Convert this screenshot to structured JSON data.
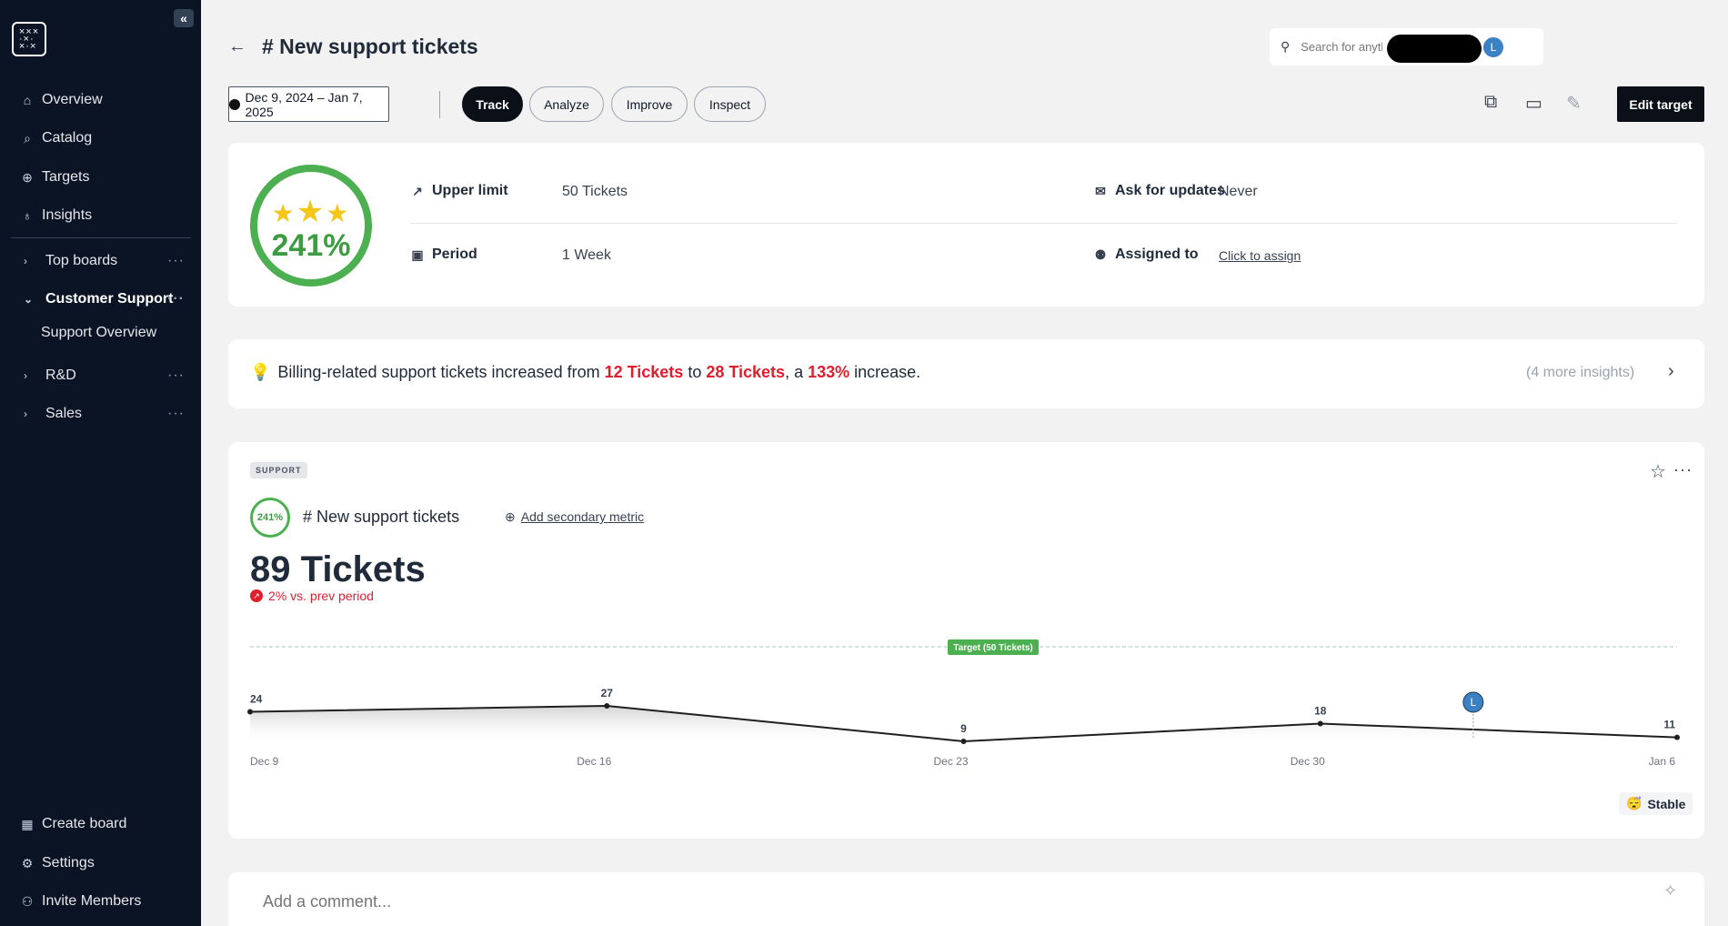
{
  "sidebar": {
    "collapse_label": "«",
    "nav": [
      {
        "label": "Overview",
        "icon": "home-icon"
      },
      {
        "label": "Catalog",
        "icon": "search-icon"
      },
      {
        "label": "Targets",
        "icon": "target-icon"
      },
      {
        "label": "Insights",
        "icon": "lightbulb-icon"
      }
    ],
    "boards": [
      {
        "label": "Top boards",
        "expanded": false
      },
      {
        "label": "Customer Support",
        "expanded": true
      },
      {
        "label": "R&D",
        "expanded": false
      },
      {
        "label": "Sales",
        "expanded": false
      }
    ],
    "sub_item": "Support Overview",
    "bottom": [
      {
        "label": "Create board",
        "icon": "table-icon"
      },
      {
        "label": "Settings",
        "icon": "gear-icon"
      },
      {
        "label": "Invite Members",
        "icon": "add-user-icon"
      }
    ]
  },
  "header": {
    "title": "# New support tickets",
    "search_placeholder": "Search for anything...",
    "avatar_initial": "L"
  },
  "toolbar": {
    "date_range": "Dec 9, 2024 – Jan 7, 2025",
    "tabs": [
      "Track",
      "Analyze",
      "Improve",
      "Inspect"
    ],
    "active_tab": "Track",
    "edit_target_label": "Edit target"
  },
  "target": {
    "percent": "241%",
    "stars": 3,
    "upper_limit_label": "Upper limit",
    "upper_limit_value": "50 Tickets",
    "period_label": "Period",
    "period_value": "1 Week",
    "ask_updates_label": "Ask for updates",
    "ask_updates_value": "Never",
    "assigned_label": "Assigned to",
    "assigned_value": "Click to assign"
  },
  "insight": {
    "prefix": "Billing-related support tickets increased from ",
    "from": "12 Tickets",
    "mid": " to ",
    "to": "28 Tickets",
    "mid2": ", a ",
    "pct": "133%",
    "suffix": " increase.",
    "more": "(4 more insights)"
  },
  "metric": {
    "tag": "SUPPORT",
    "ring_percent": "241%",
    "name": "# New support tickets",
    "add_secondary": "Add secondary metric",
    "value": "89 Tickets",
    "delta": "2% vs. prev period",
    "trend": "Stable",
    "trend_icon": "😴"
  },
  "chart_data": {
    "type": "area",
    "x": [
      "Dec 9",
      "Dec 16",
      "Dec 23",
      "Dec 30",
      "Jan 6"
    ],
    "values": [
      24,
      27,
      9,
      18,
      11
    ],
    "target_label": "Target (50 Tickets)",
    "target_value": 50,
    "annotation_marker": "L",
    "annotation_x": "Jan 2",
    "colors": {
      "line": "#1f1f1f",
      "target": "#4caf50",
      "annotation": "#3b82c4"
    }
  },
  "comment": {
    "placeholder": "Add a comment..."
  }
}
